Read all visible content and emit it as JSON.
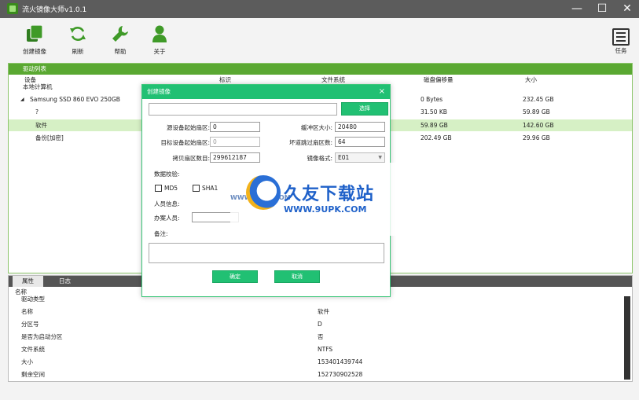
{
  "window": {
    "title": "流火镜像大师v1.0.1"
  },
  "window_controls": {
    "minimize": "—",
    "maximize": "☐",
    "close": "✕"
  },
  "toolbar": {
    "items": [
      {
        "label": "创建镜像",
        "icon": "create-image-icon"
      },
      {
        "label": "刷新",
        "icon": "refresh-icon"
      },
      {
        "label": "帮助",
        "icon": "wrench-icon"
      },
      {
        "label": "关于",
        "icon": "user-icon"
      }
    ],
    "task_label": "任务"
  },
  "drive_list": {
    "title": "驱动列表",
    "columns": [
      "设备",
      "标识",
      "文件系统",
      "磁盘偏移量",
      "大小"
    ],
    "rows": [
      {
        "device": "本地计算机",
        "id": "",
        "fs": "",
        "offset": "",
        "size": "",
        "level": 0,
        "expander": ""
      },
      {
        "device": "Samsung SSD 860 EVO 250GB",
        "id": "",
        "fs": "",
        "offset": "0 Bytes",
        "size": "232.45 GB",
        "level": 1,
        "expander": "◢"
      },
      {
        "device": "?",
        "id": "",
        "fs": "",
        "offset": "31.50 KB",
        "size": "59.89 GB",
        "level": 2,
        "expander": ""
      },
      {
        "device": "软件",
        "id": "",
        "fs": "",
        "offset": "59.89 GB",
        "size": "142.60 GB",
        "level": 2,
        "expander": "",
        "selected": true
      },
      {
        "device": "备份[加密]",
        "id": "",
        "fs": "",
        "offset": "202.49 GB",
        "size": "29.96 GB",
        "level": 2,
        "expander": ""
      }
    ]
  },
  "properties": {
    "tabs": [
      "属性",
      "日志"
    ],
    "header": "名称",
    "rows": [
      {
        "key": "驱动类型",
        "value": ""
      },
      {
        "key": "名称",
        "value": "软件"
      },
      {
        "key": "分区号",
        "value": "D"
      },
      {
        "key": "是否为启动分区",
        "value": "否"
      },
      {
        "key": "文件系统",
        "value": "NTFS"
      },
      {
        "key": "大小",
        "value": "153401439744"
      },
      {
        "key": "剩余空间",
        "value": "152730902528"
      }
    ]
  },
  "dialog": {
    "title": "创建镜像",
    "close": "×",
    "path_value": "",
    "browse_label": "选择",
    "src_start_label": "源设备起始扇区:",
    "src_start_value": "0",
    "buffer_label": "缓冲区大小:",
    "buffer_value": "20480",
    "dst_start_label": "目标设备起始扇区:",
    "dst_start_value": "0",
    "skip_label": "坏道跳过扇区数:",
    "skip_value": "64",
    "copy_count_label": "拷贝扇区数目:",
    "copy_count_value": "299612187",
    "format_label": "镜像格式:",
    "format_value": "E01",
    "verify_label": "数据校验:",
    "md5_label": "MD5",
    "sha1_label": "SHA1",
    "personnel_label": "人员信息:",
    "handler_label": "办案人员:",
    "notes_label": "备注:",
    "ok_label": "确定",
    "cancel_label": "取消"
  },
  "watermark": {
    "title": "久友下载站",
    "url": "WWW.9UPK.COM",
    "small": "WWW.9UPK.COM"
  }
}
